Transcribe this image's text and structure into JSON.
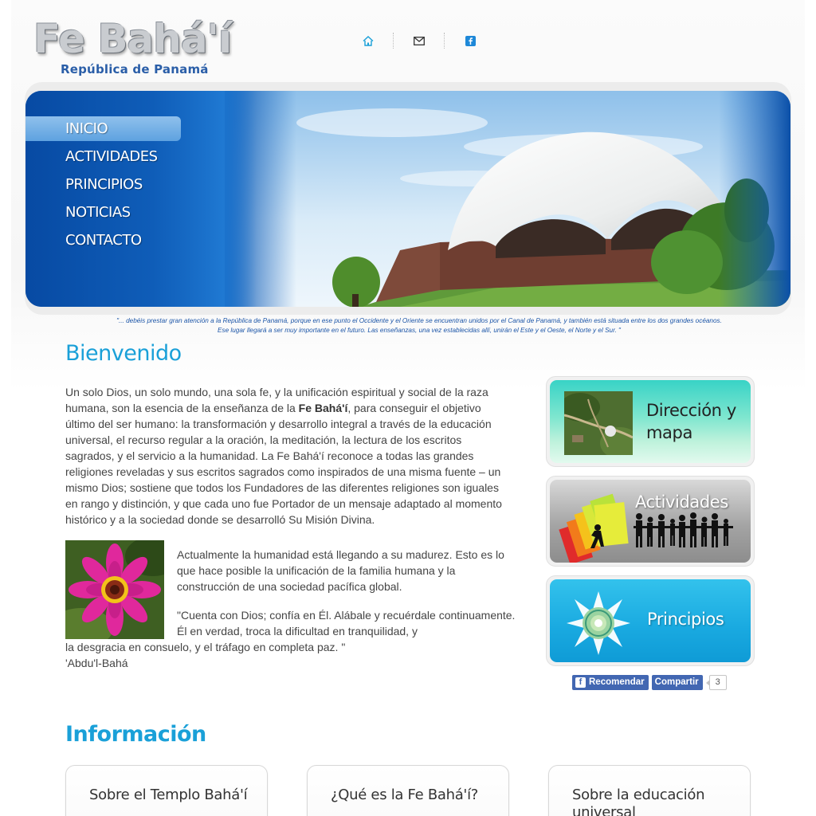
{
  "header": {
    "logo_title": "Fe Bahá'í",
    "logo_subtitle": "República de Panamá",
    "icons": [
      "home-icon",
      "mail-icon",
      "facebook-icon"
    ]
  },
  "nav": {
    "items": [
      {
        "label": "INICIO",
        "active": true
      },
      {
        "label": "ACTIVIDADES",
        "active": false
      },
      {
        "label": "PRINCIPIOS",
        "active": false
      },
      {
        "label": "NOTICIAS",
        "active": false
      },
      {
        "label": "CONTACTO",
        "active": false
      }
    ]
  },
  "banner_quote": {
    "line1": "\"... debéis prestar gran atención a la República de Panamá, porque en ese punto el Occidente y el Oriente se encuentran unidos por el Canal de Panamá,  y también está situada entre los dos grandes océanos.",
    "line2": "Ese lugar llegará a ser muy importante en el futuro. Las enseñanzas, una vez establecidas allí, unirán el Este y el Oeste, el Norte y el Sur. \""
  },
  "welcome": {
    "title": "Bienvenido",
    "intro_before": "Un solo Dios, un solo mundo, una sola fe, y la unificación espiritual y social de la raza humana, son la esencia de la enseñanza de la ",
    "intro_bold": "Fe Bahá'í",
    "intro_after": ", para conseguir el objetivo último del ser humano: la transformación y desarrollo integral a través de la educación universal, el recurso regular a la oración, la meditación, la lectura de los escritos sagrados, y el servicio a la humanidad. La Fe Bahá'í reconoce a todas las grandes religiones reveladas y sus escritos sagrados como inspirados de una misma fuente – un mismo Dios; sostiene que todos los Fundadores de las diferentes religiones son iguales en rango y distinción, y que cada uno fue Portador de un mensaje adaptado al momento histórico y a la sociedad donde se desarrolló Su Misión Divina.",
    "paragraph2": "Actualmente la humanidad está llegando a su madurez. Esto es lo que hace posible la unificación de la familia humana y la construcción de una sociedad pacífica global.",
    "quote_part1": "\"Cuenta con Dios; confía en Él. Alábale y recuérdale continuamente. Él en verdad, troca la dificultad en tranquilidad, y",
    "quote_part2": "la desgracia en consuelo, y el tráfago en completa paz. \"",
    "author": "'Abdu'l-Bahá"
  },
  "sidebar": {
    "map_label": "Dirección y mapa",
    "activities_label": "Actividades",
    "principles_label": "Principios"
  },
  "social": {
    "recommend_label": "Recomendar",
    "share_label": "Compartir",
    "count": "3"
  },
  "info": {
    "title": "Información",
    "cards": [
      "Sobre el Templo Bahá'í",
      "¿Qué es la Fe Bahá'í?",
      "Sobre la educación universal"
    ]
  },
  "colors": {
    "accent_blue": "#1aa0d8",
    "nav_blue": "#0f5db8",
    "facebook": "#4267b2"
  }
}
